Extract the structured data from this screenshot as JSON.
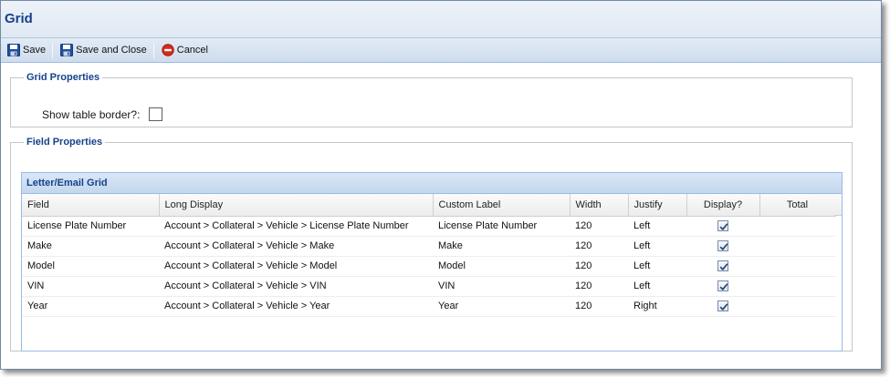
{
  "window": {
    "title": "Grid"
  },
  "toolbar": {
    "save_label": "Save",
    "save_close_label": "Save and Close",
    "cancel_label": "Cancel"
  },
  "grid_properties": {
    "legend": "Grid Properties",
    "show_border_label": "Show table border?:",
    "show_border_checked": false
  },
  "field_properties": {
    "legend": "Field Properties",
    "grid_title": "Letter/Email Grid",
    "columns": [
      "Field",
      "Long Display",
      "Custom Label",
      "Width",
      "Justify",
      "Display?",
      "Total"
    ],
    "rows": [
      {
        "field": "License Plate Number",
        "long_display": "Account > Collateral > Vehicle > License Plate Number",
        "custom_label": "License Plate Number",
        "width": "120",
        "justify": "Left",
        "display": true,
        "total": ""
      },
      {
        "field": "Make",
        "long_display": "Account > Collateral > Vehicle > Make",
        "custom_label": "Make",
        "width": "120",
        "justify": "Left",
        "display": true,
        "total": ""
      },
      {
        "field": "Model",
        "long_display": "Account > Collateral > Vehicle > Model",
        "custom_label": "Model",
        "width": "120",
        "justify": "Left",
        "display": true,
        "total": ""
      },
      {
        "field": "VIN",
        "long_display": "Account > Collateral > Vehicle > VIN",
        "custom_label": "VIN",
        "width": "120",
        "justify": "Left",
        "display": true,
        "total": ""
      },
      {
        "field": "Year",
        "long_display": "Account > Collateral > Vehicle > Year",
        "custom_label": "Year",
        "width": "120",
        "justify": "Right",
        "display": true,
        "total": ""
      }
    ]
  },
  "icons": {
    "save": "floppy-disk-icon",
    "save_close": "floppy-disk-icon",
    "cancel": "cancel-circle-icon"
  },
  "colors": {
    "title_text": "#15428b",
    "cancel_red": "#d52b1e",
    "floppy_blue": "#1f4f9c"
  }
}
